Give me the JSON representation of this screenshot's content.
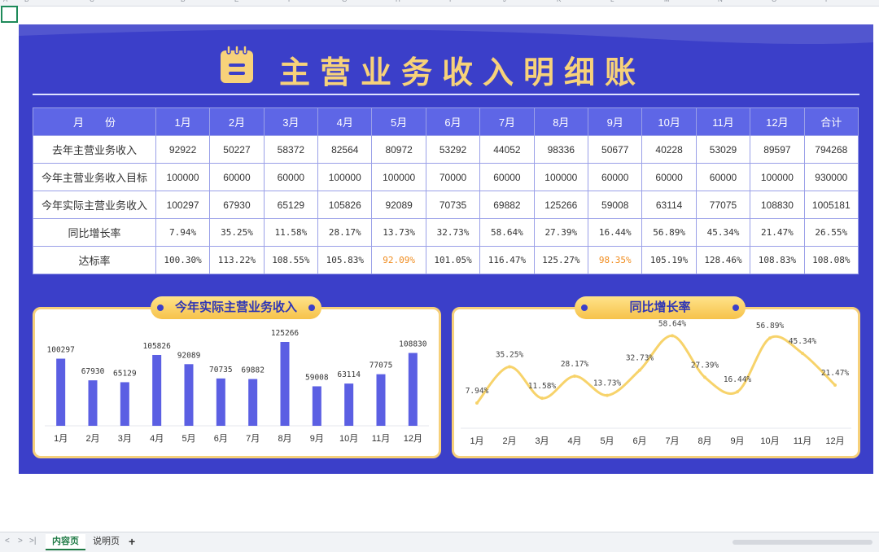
{
  "sheet": {
    "columns": [
      "A",
      "B",
      "C",
      "D",
      "E",
      "F",
      "G",
      "H",
      "I",
      "J",
      "K",
      "L",
      "M",
      "N",
      "O",
      "P"
    ],
    "tabs": [
      {
        "label": "内容页",
        "active": true
      },
      {
        "label": "说明页",
        "active": false
      }
    ],
    "add_label": "+",
    "nav": [
      "<",
      ">",
      ">|"
    ]
  },
  "title": "主营业务收入明细账",
  "table": {
    "header_label": "月　　份",
    "months": [
      "1月",
      "2月",
      "3月",
      "4月",
      "5月",
      "6月",
      "7月",
      "8月",
      "9月",
      "10月",
      "11月",
      "12月"
    ],
    "total_label": "合计",
    "rows": [
      {
        "label": "去年主营业务收入",
        "values": [
          "92922",
          "50227",
          "58372",
          "82564",
          "80972",
          "53292",
          "44052",
          "98336",
          "50677",
          "40228",
          "53029",
          "89597",
          "794268"
        ]
      },
      {
        "label": "今年主营业务收入目标",
        "values": [
          "100000",
          "60000",
          "60000",
          "100000",
          "100000",
          "70000",
          "60000",
          "100000",
          "60000",
          "60000",
          "60000",
          "100000",
          "930000"
        ]
      },
      {
        "label": "今年实际主营业务收入",
        "values": [
          "100297",
          "67930",
          "65129",
          "105826",
          "92089",
          "70735",
          "69882",
          "125266",
          "59008",
          "63114",
          "77075",
          "108830",
          "1005181"
        ]
      },
      {
        "label": "同比增长率",
        "values": [
          "7.94%",
          "35.25%",
          "11.58%",
          "28.17%",
          "13.73%",
          "32.73%",
          "58.64%",
          "27.39%",
          "16.44%",
          "56.89%",
          "45.34%",
          "21.47%",
          "26.55%"
        ]
      },
      {
        "label": "达标率",
        "values": [
          "100.30%",
          "113.22%",
          "108.55%",
          "105.83%",
          "92.09%",
          "101.05%",
          "116.47%",
          "125.27%",
          "98.35%",
          "105.19%",
          "128.46%",
          "108.83%",
          "108.08%"
        ]
      }
    ],
    "highlight_color": "#f08c1e",
    "below_target_cells": [
      4,
      8
    ]
  },
  "chart_data": [
    {
      "type": "bar",
      "title": "今年实际主营业务收入",
      "categories": [
        "1月",
        "2月",
        "3月",
        "4月",
        "5月",
        "6月",
        "7月",
        "8月",
        "9月",
        "10月",
        "11月",
        "12月"
      ],
      "values": [
        100297,
        67930,
        65129,
        105826,
        92089,
        70735,
        69882,
        125266,
        59008,
        63114,
        77075,
        108830
      ],
      "ylim": [
        0,
        135000
      ],
      "color": "#5b5fe3"
    },
    {
      "type": "line",
      "title": "同比增长率",
      "categories": [
        "1月",
        "2月",
        "3月",
        "4月",
        "5月",
        "6月",
        "7月",
        "8月",
        "9月",
        "10月",
        "11月",
        "12月"
      ],
      "values": [
        7.94,
        35.25,
        11.58,
        28.17,
        13.73,
        32.73,
        58.64,
        27.39,
        16.44,
        56.89,
        45.34,
        21.47
      ],
      "labels": [
        "7.94%",
        "35.25%",
        "11.58%",
        "28.17%",
        "13.73%",
        "32.73%",
        "58.64%",
        "27.39%",
        "16.44%",
        "56.89%",
        "45.34%",
        "21.47%"
      ],
      "ylim": [
        0,
        65
      ],
      "color": "#f7d36b"
    }
  ],
  "colors": {
    "board": "#3b3fc9",
    "header": "#5e66e6",
    "accent": "#f7d27a",
    "bar": "#5b5fe3",
    "line": "#f7d36b"
  }
}
